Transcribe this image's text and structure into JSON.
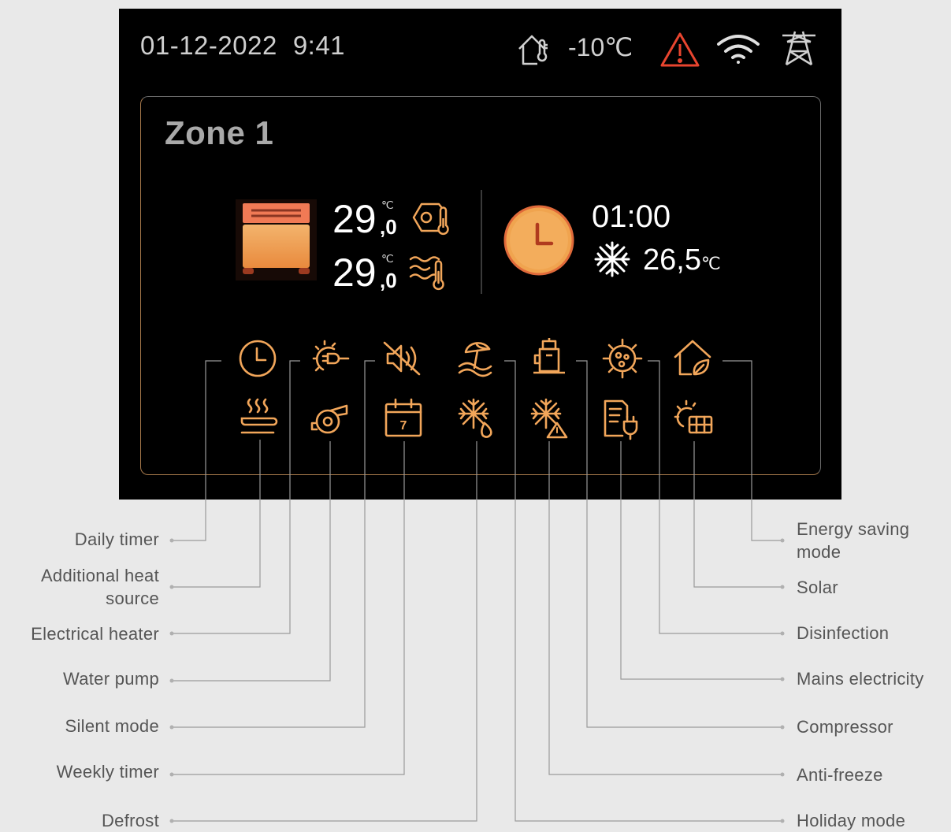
{
  "status_bar": {
    "date": "01-12-2022",
    "time": "9:41",
    "outdoor_temperature": "-10℃",
    "icons": [
      "house-thermometer-icon",
      "warning-icon",
      "wifi-icon",
      "power-tower-icon"
    ],
    "warning_color": "#e8452f"
  },
  "zone": {
    "title": "Zone 1",
    "unit_icon": "heater-unit-icon",
    "room_temp_int": "29",
    "room_temp_dec": ",0",
    "room_temp_unit": "℃",
    "room_temp_icon": "room-thermometer-icon",
    "water_temp_int": "29",
    "water_temp_dec": ",0",
    "water_temp_unit": "℃",
    "water_temp_icon": "water-thermometer-icon",
    "timer_icon": "clock-icon",
    "timer_time": "01:00",
    "cooling_icon": "snowflake-icon",
    "cooling_temp": "26,5",
    "cooling_unit": "℃"
  },
  "accent_color": "#f2a65a",
  "status_icons_row1": [
    "daily-timer-icon",
    "electrical-heater-icon",
    "silent-mode-icon",
    "holiday-mode-icon",
    "compressor-icon",
    "disinfection-icon",
    "energy-saving-icon"
  ],
  "status_icons_row2": [
    "additional-heat-source-icon",
    "water-pump-icon",
    "weekly-timer-icon",
    "defrost-icon",
    "anti-freeze-icon",
    "mains-electricity-icon",
    "solar-icon"
  ],
  "weekly_timer_day": "7",
  "labels_left": [
    {
      "text": "Daily timer"
    },
    {
      "text": "Additional heat source"
    },
    {
      "text": "Electrical heater"
    },
    {
      "text": "Water pump"
    },
    {
      "text": "Silent mode"
    },
    {
      "text": "Weekly timer"
    },
    {
      "text": "Defrost"
    }
  ],
  "labels_right": [
    {
      "text": "Energy saving mode"
    },
    {
      "text": "Solar"
    },
    {
      "text": "Disinfection"
    },
    {
      "text": "Mains electricity"
    },
    {
      "text": "Compressor"
    },
    {
      "text": "Anti-freeze"
    },
    {
      "text": "Holiday mode"
    }
  ]
}
